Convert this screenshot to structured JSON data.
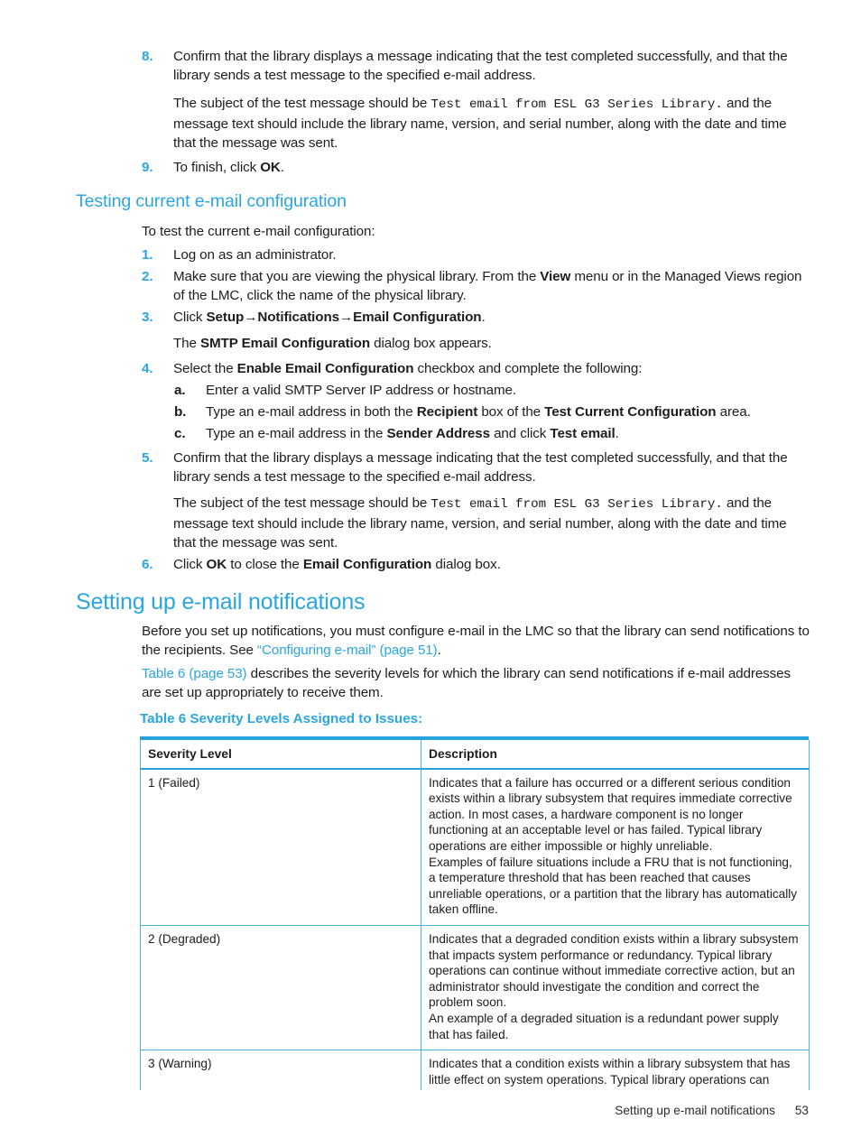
{
  "document": {
    "footer_section": "Setting up e-mail notifications",
    "footer_page_number": "53",
    "accent_color": "#2ba6e0",
    "table_border_color": "#4eb3e4"
  },
  "top_steps": [
    {
      "marker": "8.",
      "text": "Confirm that the library displays a message indicating that the test completed successfully, and that the library sends a test message to the specified e-mail address."
    },
    {
      "marker": "9.",
      "text_before": "To finish, click ",
      "bold": "OK",
      "text_after": "."
    }
  ],
  "top_note": {
    "lead": "The subject of the test message should be ",
    "mono": "Test email from ESL G3 Series Library.",
    "tail": " and the message text should include the library name, version, and serial number, along with the date and time that the message was sent."
  },
  "section_testing": {
    "heading": "Testing current e-mail configuration",
    "intro": "To test the current e-mail configuration:",
    "steps": [
      {
        "marker": "1.",
        "text": "Log on as an administrator."
      },
      {
        "marker": "2.",
        "p1": "Make sure that you are viewing the physical library. From the ",
        "b1": "View",
        "p2": " menu or in the Managed Views region of the LMC, click the name of the physical library."
      },
      {
        "marker": "3.",
        "p1": "Click ",
        "b1": "Setup",
        "arrow1": "→",
        "b2": "Notifications",
        "arrow2": "→",
        "b3": "Email Configuration",
        "p2": ".",
        "sub_note_p1": "The ",
        "sub_note_b": "SMTP Email Configuration",
        "sub_note_p2": " dialog box appears."
      },
      {
        "marker": "4.",
        "p1": "Select the ",
        "b1": "Enable Email Configuration",
        "p2": " checkbox and complete the following:",
        "sub_items": [
          {
            "marker": "a.",
            "p1": "Enter a valid SMTP Server IP address or hostname."
          },
          {
            "marker": "b.",
            "p1": "Type an e-mail address in both the ",
            "b1": "Recipient",
            "p2": " box of the ",
            "b2": "Test Current Configuration",
            "p3": " area."
          },
          {
            "marker": "c.",
            "p1": "Type an e-mail address in the ",
            "b1": "Sender Address",
            "p2": " and click ",
            "b2": "Test email",
            "p3": "."
          }
        ]
      },
      {
        "marker": "5.",
        "text": "Confirm that the library displays a message indicating that the test completed successfully, and that the library sends a test message to the specified e-mail address."
      },
      {
        "marker": "6.",
        "p1": "Click ",
        "b1": "OK",
        "p2": " to close the ",
        "b2": "Email Configuration",
        "p3": " dialog box."
      }
    ],
    "note": {
      "lead": "The subject of the test message should be ",
      "mono": "Test email from ESL G3 Series Library.",
      "tail": " and the message text should include the library name, version, and serial number, along with the date and time that the message was sent."
    }
  },
  "section_notifications": {
    "heading": "Setting up e-mail notifications",
    "para1_a": "Before you set up notifications, you must configure e-mail in the LMC so that the library can send notifications to the recipients. See ",
    "para1_link": "“Configuring e-mail” (page 51)",
    "para1_b": ".",
    "para2_link": "Table 6 (page 53)",
    "para2_b": " describes the severity levels for which the library can send notifications if e-mail addresses are set up appropriately to receive them.",
    "table_caption": "Table 6 Severity Levels Assigned to Issues:",
    "table": {
      "headers": [
        "Severity Level",
        "Description"
      ],
      "rows": [
        {
          "severity": "1 (Failed)",
          "description": [
            "Indicates that a failure has occurred or a different serious condition exists within a library subsystem that requires immediate corrective action. In most cases, a hardware component is no longer functioning at an acceptable level or has failed. Typical library operations are either impossible or highly unreliable.",
            "Examples of failure situations include a FRU that is not functioning, a temperature threshold that has been reached that causes unreliable operations, or a partition that the library has automatically taken offline."
          ]
        },
        {
          "severity": "2 (Degraded)",
          "description": [
            "Indicates that a degraded condition exists within a library subsystem that impacts system performance or redundancy. Typical library operations can continue without immediate corrective action, but an administrator should investigate the condition and correct the problem soon.",
            "An example of a degraded situation is a redundant power supply that has failed."
          ]
        },
        {
          "severity": "3 (Warning)",
          "description": [
            "Indicates that a condition exists within a library subsystem that has little effect on system operations. Typical library operations can continue without immediate corrective action, but you should"
          ]
        }
      ]
    }
  }
}
